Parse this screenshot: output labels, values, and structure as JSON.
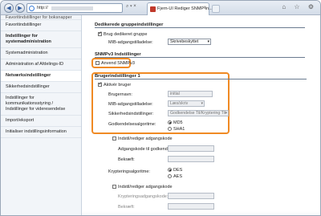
{
  "browser": {
    "url_prefix": "http://",
    "tab_title": "Fjern-UI Rediger SNMP-in...",
    "tab_close": "×",
    "address_icons": "⌕ ▾ ×",
    "tools": "⌂ ☆ ⚙"
  },
  "sidebar": {
    "items": [
      {
        "label": "Favoritindstillinger for boksnapper",
        "kind": "cut"
      },
      {
        "label": "Favoritindstillinger",
        "kind": "normal"
      },
      {
        "label": "Indstillinger for systemadministration",
        "kind": "head"
      },
      {
        "label": "Systemadministration",
        "kind": "normal"
      },
      {
        "label": "Administration af Afdelings-ID",
        "kind": "normal"
      },
      {
        "label": "Netværksindstillinger",
        "kind": "active"
      },
      {
        "label": "Sikkerhedsindstillinger",
        "kind": "normal"
      },
      {
        "label": "Indstillinger for kommunikationsstyring / Indstillinger for videresendelse",
        "kind": "normal"
      },
      {
        "label": "Import/eksport",
        "kind": "normal"
      },
      {
        "label": "Initialiser indstillingsinformation",
        "kind": "normal"
      }
    ]
  },
  "main": {
    "dedicated": {
      "title": "Dedikerede gruppeindstillinger",
      "use_group_label": "Brug dedikeret gruppe",
      "use_group_checked": true,
      "mib_access_label": "MIB-adgangstilladelse:",
      "mib_access_value": "Skrivebeskyttet"
    },
    "snmpv3": {
      "title": "SNMPv3 Indstillinger",
      "use_label": "Anvend SNMPv3",
      "use_checked": false
    },
    "user": {
      "title": "Brugerindstillinger 1",
      "activate_label": "Aktivér bruger",
      "activate_checked": true,
      "username_label": "Brugernavn:",
      "username_value": "initial",
      "mib_label": "MIB-adgangstilladelse:",
      "mib_value": "Læs/skriv",
      "security_label": "Sikkerhedsindstillinger:",
      "security_value": "Godkendelse Til/Kryptering Til",
      "auth_algo_label": "Godkendelsesalgoritme:",
      "auth_opt1": "MD5",
      "auth_opt2": "SHA1",
      "set_auth_pw_label": "Indstil/rediger adgangskode",
      "auth_pw_label": "Adgangskode til godkendelse:",
      "confirm_label": "Bekræft:",
      "enc_algo_label": "Krypteringsalgoritme:",
      "enc_opt1": "DES",
      "enc_opt2": "AES",
      "set_enc_pw_label": "Indstil/rediger adgangskode",
      "enc_pw_label": "Krypteringsadgangskode:",
      "confirm2_label": "Bekræft:"
    }
  }
}
